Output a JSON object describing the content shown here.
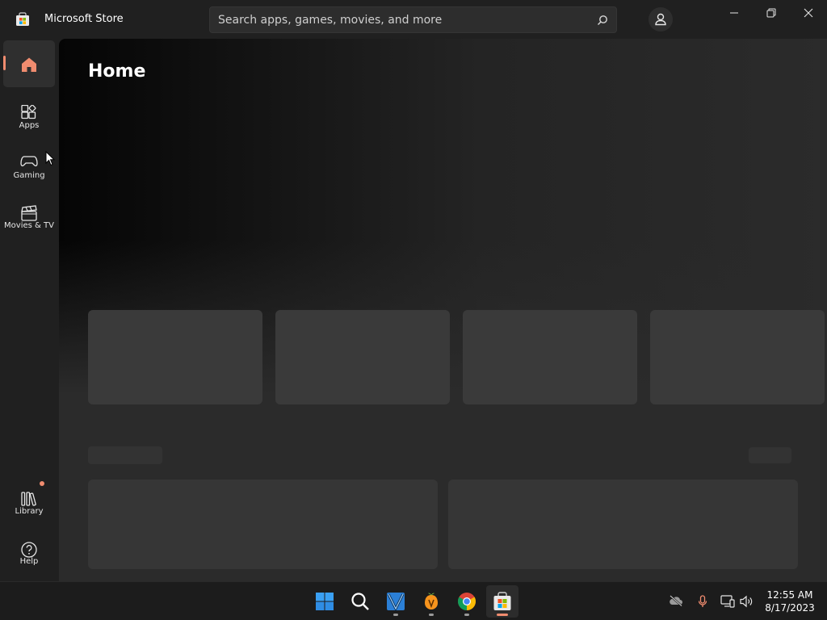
{
  "app": {
    "title": "Microsoft Store"
  },
  "search": {
    "placeholder": "Search apps, games, movies, and more"
  },
  "sidebar": {
    "items": [
      {
        "id": "home",
        "label": "",
        "icon": "home-icon",
        "active": true
      },
      {
        "id": "apps",
        "label": "Apps",
        "icon": "apps-icon"
      },
      {
        "id": "gaming",
        "label": "Gaming",
        "icon": "gamepad-icon"
      },
      {
        "id": "movies",
        "label": "Movies & TV",
        "icon": "clapperboard-icon"
      },
      {
        "id": "library",
        "label": "Library",
        "icon": "library-icon",
        "badge": true
      },
      {
        "id": "help",
        "label": "Help",
        "icon": "help-icon"
      }
    ]
  },
  "main": {
    "title": "Home"
  },
  "taskbar": {
    "apps": [
      "start-icon",
      "search-icon",
      "video-editor-icon",
      "fl-studio-icon",
      "chrome-icon",
      "microsoft-store-icon"
    ],
    "time": "12:55 AM",
    "date": "8/17/2023"
  },
  "colors": {
    "accent": "#f08c6f",
    "background": "#202020",
    "content": "#2b2b2b"
  }
}
